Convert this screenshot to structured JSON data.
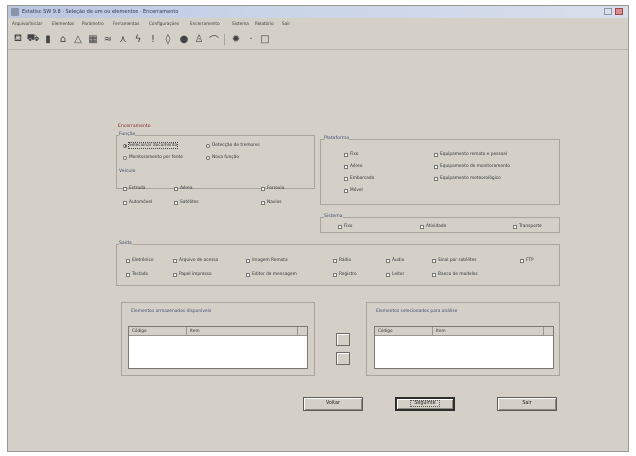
{
  "window": {
    "title": "Estatisc SW 9.8 · Seleção de um ou elementos · Encerramento"
  },
  "menu": [
    "Arquivo/Iniciar",
    "Elementos",
    "Parâmetro",
    "Ferramentas",
    "Configurações",
    "Encerramento",
    "Sistema",
    "Relatório",
    "Sair"
  ],
  "toolbar_icons": [
    "chair-icon",
    "car-icon",
    "bottle-icon",
    "home-icon",
    "house-icon",
    "building-icon",
    "wave-icon",
    "bird-icon",
    "lightning-icon",
    "thermometer-icon",
    "droplet-icon",
    "pot-icon",
    "person-icon",
    "line-icon",
    "gear-icon",
    "arrow-icon",
    "square-icon"
  ],
  "form": {
    "title": "Encerramento",
    "funcao": {
      "title": "Função",
      "options": [
        {
          "label": "Selecionar documento",
          "selected": true
        },
        {
          "label": "Detecção de tremores",
          "selected": false
        },
        {
          "label": "Monitoramento por fonte",
          "selected": false
        },
        {
          "label": "Nova função",
          "selected": false
        }
      ]
    },
    "veiculo": {
      "title": "Veículo",
      "items": [
        "Estrada",
        "Aérea",
        "Ferrovia",
        "Automóvel",
        "Satélites",
        "Navios"
      ]
    },
    "plataforma": {
      "title": "Plataforma",
      "left": [
        "Fixo",
        "Aéreo",
        "Embarcado",
        "Móvel"
      ],
      "right": [
        "Equipamento remoto e pessoal",
        "Equipamento de monitoramento",
        "Equipamento meteorológico"
      ]
    },
    "sistema": {
      "title": "Sistema",
      "items": [
        "Fixo",
        "Atividade",
        "Transporte"
      ]
    },
    "saida": {
      "title": "Saída",
      "row1": [
        "Eletrônico",
        "Arquivo de acesso",
        "Imagem Remota",
        "Rádio",
        "Áudio",
        "Sinal por satélites",
        "FTP"
      ],
      "row2": [
        "Teclado",
        "Papel impresso",
        "Editor de mensagem",
        "Registro",
        "Leitor",
        "Banco de modelos"
      ]
    },
    "left_list": {
      "title": "Elementos armazenados disponíveis",
      "columns": [
        "Código",
        "Item"
      ]
    },
    "right_list": {
      "title": "Elementos selecionados para análise",
      "columns": [
        "Código",
        "Item"
      ]
    },
    "move_right_label": "",
    "move_left_label": ""
  },
  "buttons": {
    "back": "Voltar",
    "next": "Seguinte",
    "exit": "Sair"
  }
}
